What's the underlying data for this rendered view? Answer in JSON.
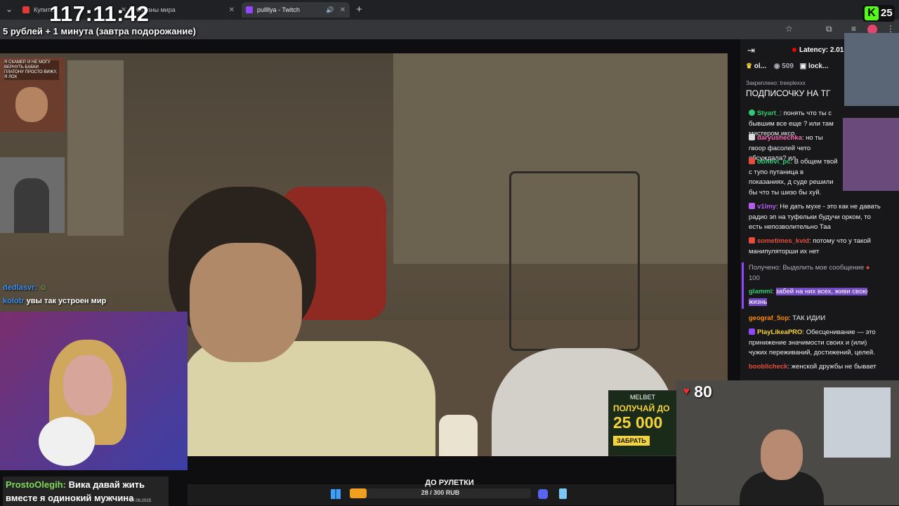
{
  "browser": {
    "tabs": [
      {
        "label": "Купить",
        "active": false
      },
      {
        "label": "Страны мира",
        "active": false
      },
      {
        "label": "pullllya - Twitch",
        "active": true
      }
    ],
    "new_tab": "+",
    "menu_chevron": "⌄"
  },
  "overlay": {
    "timer": "117:11:42",
    "subtitle": "5 рублей + 1 минута (завтра подорожание)"
  },
  "ad": {
    "brand": "MELBET",
    "line1": "ПОЛУЧАЙ ДО",
    "amount": "25 000",
    "cta": "ЗАБРАТЬ"
  },
  "left_cam_note": "Я СКАМЕР. И НЕ МОГУ ВЕРНУТЬ БАБКИ ПЛАТОНУ ПРОСТО ВИЖУ, Я ЛОХ",
  "left_chat": [
    {
      "user": "dedlasvr:",
      "text": "",
      "color": "#3a8cf0"
    },
    {
      "user": "kolotr",
      "text": "увы так устроен мир",
      "color": "#3a8cf0"
    }
  ],
  "bottom_chat": {
    "user": "ProstoOlegih:",
    "text_line1": "Вика давай жить",
    "text_line2": "вместе я одинокий мужчина",
    "date": "17.09.2025"
  },
  "roulette": {
    "label": "ДО РУЛЕТКИ",
    "progress_text": "28 / 300 RUB",
    "progress": 0.093
  },
  "kick_badge": {
    "letter": "K",
    "count": "25"
  },
  "viewers": {
    "count": "80"
  },
  "chat_panel": {
    "latency": "Latency: 2.01s",
    "channel1": "ol...",
    "viewers1": "509",
    "channel2": "lock...",
    "pinned_by": "Закреплено: treeplexxx",
    "pinned_text": "ПОДПИСОЧКУ НА ТГ",
    "messages": [
      {
        "user": "Styart_",
        "text": "понять что ты с бывшим все еще ? или там мистером иксо",
        "color": "#2ecc71",
        "badge": "#2ecc71"
      },
      {
        "user": "daryushechka",
        "text": "но ты гвоор фасолей чето обсуждала? ил",
        "color": "#ff69b4",
        "badge": "#dddddd"
      },
      {
        "user": "obnovi_pc",
        "text": "В общем твой с тупо путаница в показаниях, д суде решили бы что ты шизо бы хуй.",
        "color": "#2ecc71",
        "badge": "#e74c3c"
      },
      {
        "user": "v1lmy",
        "text": "Не дать мухе - это как не давать радио эп на туфельки будучи орком, то есть непозволительно Таа",
        "color": "#b45cf0",
        "badge": "#b45cf0"
      },
      {
        "user": "sometimes_kvid",
        "text": "потому что у такой манипуляторши их нет",
        "color": "#e74c3c",
        "badge": "#e74c3c"
      },
      {
        "user": "Получено: Выделить мое сообщение",
        "text": "100",
        "color": "#adadb8",
        "badge": ""
      },
      {
        "user": "glammi",
        "text": "забей на них всех, живи свою жизнь",
        "color": "#2ecc71",
        "badge": "",
        "highlight": true
      },
      {
        "user": "geograf_5op",
        "text": "ТАК ИДИИ",
        "color": "#ff8c00",
        "badge": ""
      },
      {
        "user": "PlayLikeaPRO",
        "text": "Обесценивание — это принижение значимости своих и (или) чужих переживаний, достижений, целей.",
        "color": "#f5d33a",
        "badge": "#9147ff"
      },
      {
        "user": "booblicheck",
        "text": "женской дружбы не бывает",
        "color": "#e74c3c",
        "badge": ""
      }
    ]
  }
}
